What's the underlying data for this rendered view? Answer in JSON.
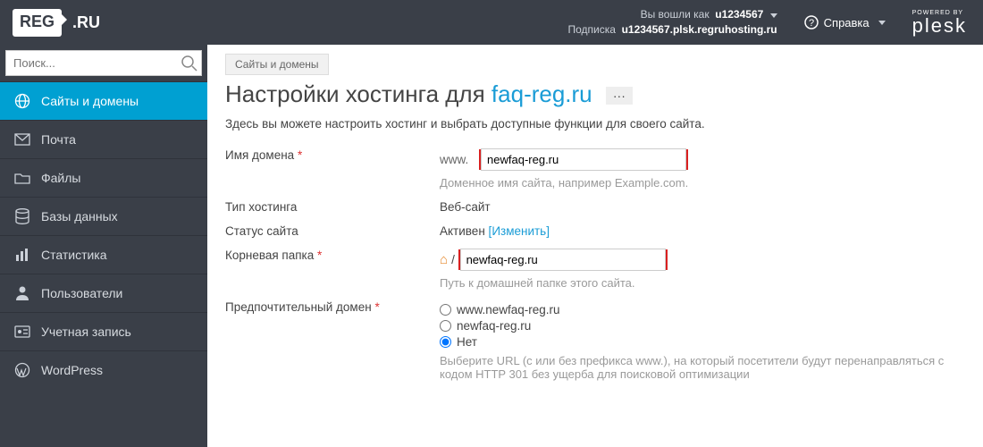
{
  "header": {
    "logo_badge": "REG",
    "logo_tail": ".RU",
    "logged_in_as_label": "Вы вошли как",
    "username": "u1234567",
    "subscription_label": "Подписка",
    "subscription_value": "u1234567.plsk.regruhosting.ru",
    "help": "Справка",
    "powered_by": "POWERED BY",
    "plesk": "plesk"
  },
  "search": {
    "placeholder": "Поиск..."
  },
  "sidebar": {
    "items": [
      {
        "label": "Сайты и домены"
      },
      {
        "label": "Почта"
      },
      {
        "label": "Файлы"
      },
      {
        "label": "Базы данных"
      },
      {
        "label": "Статистика"
      },
      {
        "label": "Пользователи"
      },
      {
        "label": "Учетная запись"
      },
      {
        "label": "WordPress"
      }
    ]
  },
  "breadcrumb": {
    "item": "Сайты и домены"
  },
  "page": {
    "title_prefix": "Настройки хостинга для ",
    "domain": "faq-reg.ru",
    "lead": "Здесь вы можете настроить хостинг и выбрать доступные функции для своего сайта."
  },
  "form": {
    "domain_name": {
      "label": "Имя домена",
      "www": "www.",
      "value": "newfaq-reg.ru",
      "hint": "Доменное имя сайта, например Example.com."
    },
    "hosting_type": {
      "label": "Тип хостинга",
      "value": "Веб-сайт"
    },
    "site_status": {
      "label": "Статус сайта",
      "value": "Активен",
      "change": "Изменить"
    },
    "root_dir": {
      "label": "Корневая папка",
      "value": "newfaq-reg.ru",
      "hint": "Путь к домашней папке этого сайта."
    },
    "preferred_domain": {
      "label": "Предпочтительный домен",
      "options": [
        {
          "label": "www.newfaq-reg.ru"
        },
        {
          "label": "newfaq-reg.ru"
        },
        {
          "label": "Нет"
        }
      ],
      "selected_index": 2,
      "hint": "Выберите URL (с или без префикса www.), на который посетители будут перенаправляться с кодом HTTP 301 без ущерба для поисковой оптимизации"
    }
  }
}
